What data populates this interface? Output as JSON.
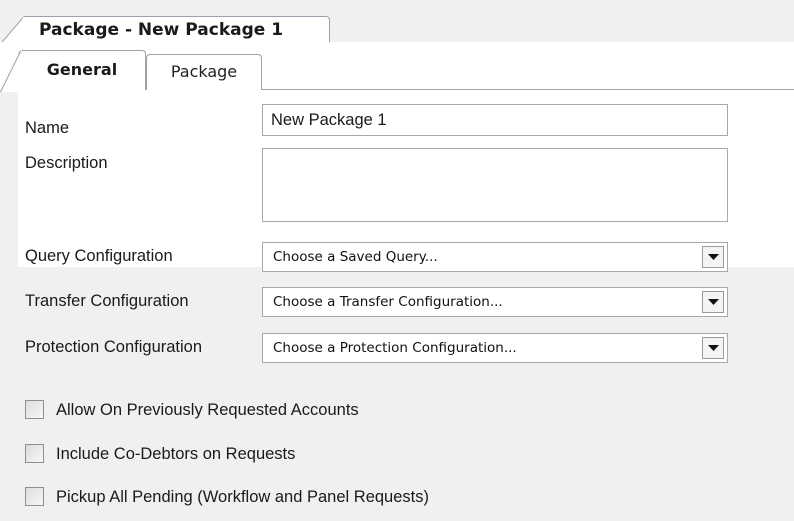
{
  "document_tab": {
    "title": "Package - New Package 1"
  },
  "tabs": [
    {
      "label": "General",
      "active": true
    },
    {
      "label": "Package",
      "active": false
    }
  ],
  "form": {
    "name": {
      "label": "Name",
      "value": "New Package 1"
    },
    "description": {
      "label": "Description",
      "value": ""
    },
    "query_configuration": {
      "label": "Query Configuration",
      "selected": "Choose a Saved Query..."
    },
    "transfer_configuration": {
      "label": "Transfer Configuration",
      "selected": "Choose a Transfer Configuration..."
    },
    "protection_configuration": {
      "label": "Protection Configuration",
      "selected": "Choose a Protection Configuration..."
    }
  },
  "options": [
    {
      "label": "Allow On Previously Requested Accounts",
      "checked": false
    },
    {
      "label": "Include Co-Debtors on Requests",
      "checked": false
    },
    {
      "label": "Pickup All Pending (Workflow and Panel Requests)",
      "checked": false
    }
  ],
  "colors": {
    "border": "#9aa3ad",
    "panel": "#f0f0f0",
    "field_border": "#a8a8a8"
  }
}
